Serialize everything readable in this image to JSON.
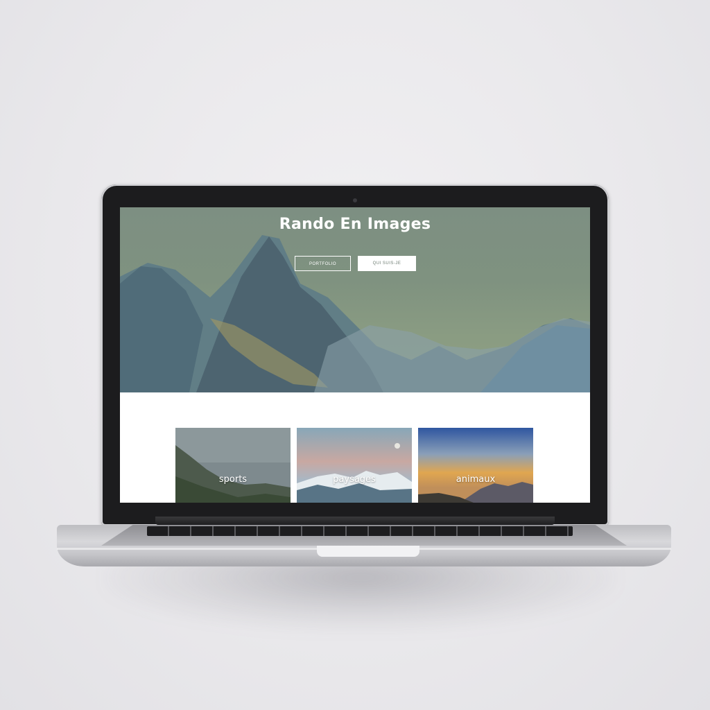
{
  "site": {
    "title": "Rando En Images",
    "buttons": {
      "portfolio": "Portfolio",
      "about": "Qui suis-je"
    },
    "categories": [
      {
        "label": "sports"
      },
      {
        "label": "paysages"
      },
      {
        "label": "animaux"
      }
    ]
  },
  "colors": {
    "hero_tint": "#7f9280",
    "page_background": "#ffffff",
    "button_text_dark": "#6b7a70"
  },
  "icons": {
    "camera": "webcam-dot"
  }
}
